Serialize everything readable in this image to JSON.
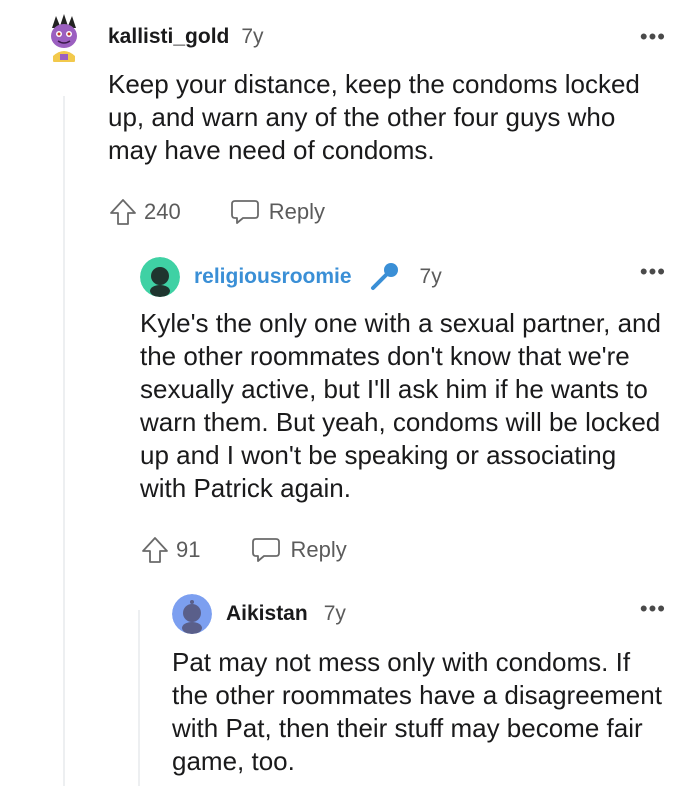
{
  "comments": [
    {
      "username": "kallisti_gold",
      "age": "7y",
      "body": "Keep your distance, keep the condoms locked up, and warn any of the other four guys who may have need of condoms.",
      "votes": "240",
      "reply_label": "Reply",
      "more_label": "•••"
    },
    {
      "username": "religiousroomie",
      "age": "7y",
      "body": "Kyle's the only one with a sexual partner, and the other roommates don't know that we're sexually active, but I'll ask him if he wants to warn them. But yeah, condoms will be locked up and I won't be speaking or associating with Patrick again.",
      "votes": "91",
      "reply_label": "Reply",
      "more_label": "•••",
      "is_op": true,
      "username_color": "#3a8fd6"
    },
    {
      "username": "Aikistan",
      "age": "7y",
      "body": "Pat may not mess only with condoms. If the other roommates have a disagreement with Pat, then their stuff may become fair game, too.",
      "more_label": "•••"
    }
  ],
  "icons": {
    "upvote": "upvote-icon",
    "reply": "reply-icon",
    "op": "microphone-icon"
  }
}
